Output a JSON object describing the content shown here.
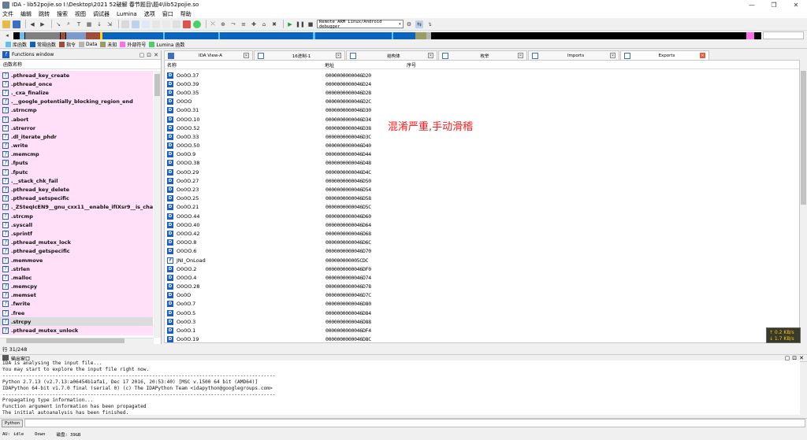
{
  "window": {
    "title": "IDA - lib52pojie.so I:\\Desktop\\2021 52破解 春节题目\\题4\\lib52pojie.so"
  },
  "menu": [
    "文件",
    "编辑",
    "跳转",
    "搜索",
    "视图",
    "调试器",
    "Lumina",
    "选项",
    "窗口",
    "帮助"
  ],
  "toolbar": {
    "debugger": "Remote ARM Linux/Android debugger"
  },
  "legend": [
    {
      "label": "库函数",
      "color": "#62bff2"
    },
    {
      "label": "常规函数",
      "color": "#0a64bd"
    },
    {
      "label": "指令",
      "color": "#a04c3a"
    },
    {
      "label": "Data",
      "color": "#b5b5b5"
    },
    {
      "label": "未知",
      "color": "#9b9b64"
    },
    {
      "label": "外部符号",
      "color": "#ff6ee8"
    },
    {
      "label": "Lumina 函数",
      "color": "#4ccf6a"
    }
  ],
  "functions_window": {
    "title": "Functions window",
    "column": "函数名称",
    "items": [
      ".pthread_key_create",
      ".pthread_once",
      "._cxa_finalize",
      ".__google_potentially_blocking_region_end",
      ".strncmp",
      ".abort",
      ".strerror",
      ".dl_iterate_phdr",
      ".write",
      ".memcmp",
      ".fputs",
      ".fputc",
      ".__stack_chk_fail",
      ".pthread_key_delete",
      ".pthread_setspecific",
      "._ZSteqIcEN9__gnu_cxx11__enable_ifIXsr9__is_charIT_EE7_v",
      ".strcmp",
      ".syscall",
      ".sprintf",
      ".pthread_mutex_lock",
      ".pthread_getspecific",
      ".memmove",
      ".strlen",
      ".malloc",
      ".memcpy",
      ".memset",
      ".fwrite",
      ".free",
      ".strcpy",
      ".pthread_mutex_unlock"
    ],
    "selected_index": 28,
    "line_count": "行 31/248"
  },
  "tabs": [
    {
      "label": "IDA View-A",
      "active": false
    },
    {
      "label": "16进制-1",
      "active": false
    },
    {
      "label": "结构体",
      "active": false
    },
    {
      "label": "枚举",
      "active": false
    },
    {
      "label": "Imports",
      "active": false
    },
    {
      "label": "Exports",
      "active": true
    }
  ],
  "exports": {
    "headers": [
      "名称",
      "地址",
      "序号"
    ],
    "rows": [
      {
        "name": "Oo0O.37",
        "addr": "0000000000046D20",
        "type": "D"
      },
      {
        "name": "Oo0O.39",
        "addr": "0000000000046D24",
        "type": "D"
      },
      {
        "name": "Oo0O.35",
        "addr": "0000000000046D28",
        "type": "D"
      },
      {
        "name": "O0OO",
        "addr": "0000000000046D2C",
        "type": "D"
      },
      {
        "name": "Oo0O.31",
        "addr": "0000000000046D30",
        "type": "D"
      },
      {
        "name": "O0OO.10",
        "addr": "0000000000046D34",
        "type": "D"
      },
      {
        "name": "O0OO.52",
        "addr": "0000000000046D38",
        "type": "D"
      },
      {
        "name": "Oo0O.33",
        "addr": "0000000000046D3C",
        "type": "D"
      },
      {
        "name": "O0OO.50",
        "addr": "0000000000046D40",
        "type": "D"
      },
      {
        "name": "Oo0O.9",
        "addr": "0000000000046D44",
        "type": "D"
      },
      {
        "name": "O0OO.38",
        "addr": "0000000000046D48",
        "type": "D"
      },
      {
        "name": "Oo0O.29",
        "addr": "0000000000046D4C",
        "type": "D"
      },
      {
        "name": "Oo0O.27",
        "addr": "0000000000046D50",
        "type": "D"
      },
      {
        "name": "Oo0O.23",
        "addr": "0000000000046D54",
        "type": "D"
      },
      {
        "name": "Oo0O.25",
        "addr": "0000000000046D58",
        "type": "D"
      },
      {
        "name": "Oo0O.21",
        "addr": "0000000000046D5C",
        "type": "D"
      },
      {
        "name": "O0OO.44",
        "addr": "0000000000046D60",
        "type": "D"
      },
      {
        "name": "O0OO.40",
        "addr": "0000000000046D64",
        "type": "D"
      },
      {
        "name": "O0OO.42",
        "addr": "0000000000046D68",
        "type": "D"
      },
      {
        "name": "O0OO.8",
        "addr": "0000000000046D6C",
        "type": "D"
      },
      {
        "name": "O0OO.6",
        "addr": "0000000000046D70",
        "type": "D"
      },
      {
        "name": "JNI_OnLoad",
        "addr": "000000000005CDC",
        "type": "F"
      },
      {
        "name": "O0OO.2",
        "addr": "0000000000046DF0",
        "type": "D"
      },
      {
        "name": "O0OO.4",
        "addr": "0000000000046D74",
        "type": "D"
      },
      {
        "name": "O0OO.28",
        "addr": "0000000000046D78",
        "type": "D"
      },
      {
        "name": "Oo0O",
        "addr": "0000000000046D7C",
        "type": "D"
      },
      {
        "name": "Oo0O.7",
        "addr": "0000000000046D80",
        "type": "D"
      },
      {
        "name": "Oo0O.5",
        "addr": "0000000000046D84",
        "type": "D"
      },
      {
        "name": "Oo0O.3",
        "addr": "0000000000046D88",
        "type": "D"
      },
      {
        "name": "Oo0O.1",
        "addr": "0000000000046DF4",
        "type": "D"
      },
      {
        "name": "Oo0O.19",
        "addr": "0000000000046D8C",
        "type": "D"
      }
    ]
  },
  "annotation": "混淆严重,手动滑稽",
  "netmon": {
    "up": "↑ 0.2 KB/s",
    "down": "↓ 1.7 KB/s"
  },
  "output": {
    "title": "输出窗口",
    "lines": [
      "IDA is analysing the input file...",
      "You may start to explore the input file right now.",
      "---------------------------------------------------------------------------------------------",
      "Python 2.7.13 (v2.7.13:a06454b1afa1, Dec 17 2016, 20:53:40) [MSC v.1500 64 bit (AMD64)]",
      "IDAPython 64-bit v1.7.0 final (serial 0) (c) The IDAPython Team <idapython@googlegroups.com>",
      "---------------------------------------------------------------------------------------------",
      "Propagating type information...",
      "Function argument information has been propagated",
      "The initial autoanalysis has been finished."
    ],
    "python_button": "Python"
  },
  "status": {
    "au": "AU:",
    "state": "idle",
    "mode": "Down",
    "disk": "磁盘: 39GB"
  },
  "colors": {
    "func_bg": "#ffe0f8",
    "accent": "#1c5fbf",
    "annotation": "#ff1a1a"
  }
}
